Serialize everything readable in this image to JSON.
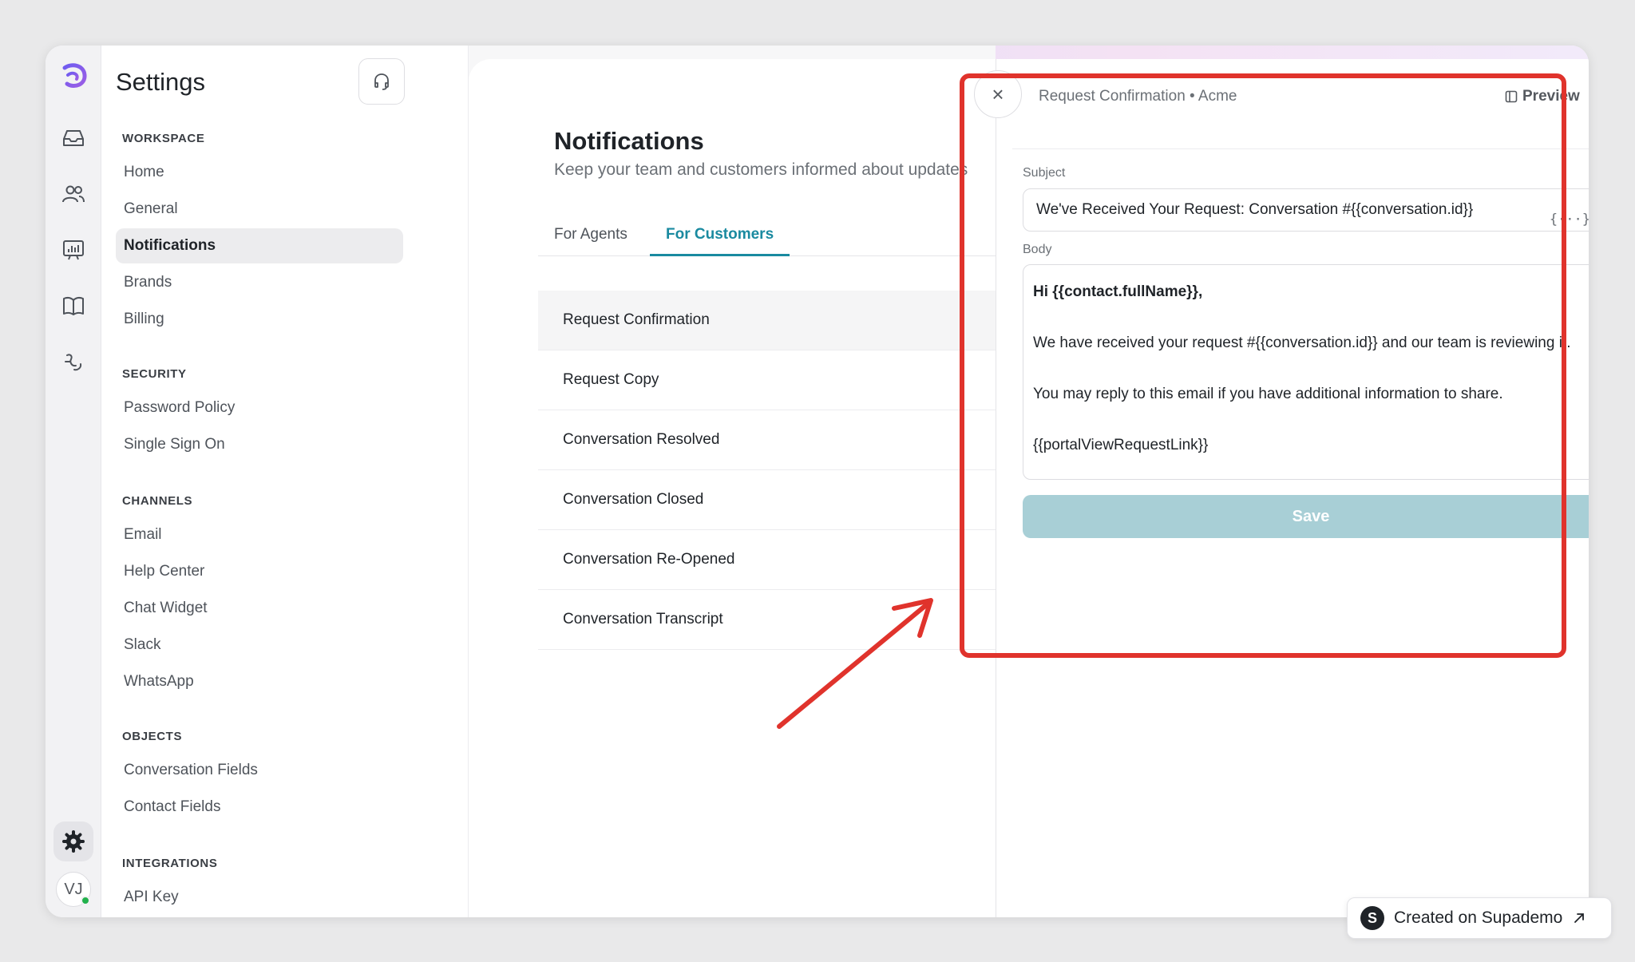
{
  "sidebar": {
    "title": "Settings",
    "sections": [
      {
        "title": "WORKSPACE",
        "items": [
          "Home",
          "General",
          "Notifications",
          "Brands",
          "Billing"
        ]
      },
      {
        "title": "SECURITY",
        "items": [
          "Password Policy",
          "Single Sign On"
        ]
      },
      {
        "title": "CHANNELS",
        "items": [
          "Email",
          "Help Center",
          "Chat Widget",
          "Slack",
          "WhatsApp"
        ]
      },
      {
        "title": "OBJECTS",
        "items": [
          "Conversation Fields",
          "Contact Fields"
        ]
      },
      {
        "title": "INTEGRATIONS",
        "items": [
          "API Key"
        ]
      }
    ],
    "active_item": "Notifications"
  },
  "rail": {
    "avatar_initials": "VJ",
    "icons": [
      "app-logo-icon",
      "inbox-icon",
      "users-icon",
      "reports-icon",
      "knowledge-book-icon",
      "workflow-icon",
      "gear-icon"
    ]
  },
  "main": {
    "heading": "Notifications",
    "subheading": "Keep your team and customers informed about updates",
    "tabs": [
      {
        "label": "For Agents"
      },
      {
        "label": "For Customers"
      }
    ],
    "active_tab": "For Customers",
    "rows": [
      "Request Confirmation",
      "Request Copy",
      "Conversation Resolved",
      "Conversation Closed",
      "Conversation Re-Opened",
      "Conversation Transcript"
    ]
  },
  "panel": {
    "title": "Request Confirmation • Acme",
    "preview_label": "Preview",
    "subject_label": "Subject",
    "subject_value": "We've Received Your Request: Conversation #{{conversation.id}}",
    "variable_icon": "{···}",
    "body_label": "Body",
    "body": {
      "greeting": "Hi {{contact.fullName}},",
      "line1": "We have received your request #{{conversation.id}} and our team is reviewing it.",
      "line2": "You may reply to this email if you have additional information to share.",
      "line3": "{{portalViewRequestLink}}"
    },
    "save_label": "Save"
  },
  "badge": {
    "logo_letter": "S",
    "text": "Created on Supademo"
  },
  "colors": {
    "accent": "#1a8aa0",
    "save_disabled": "#a8cfd6",
    "highlight": "#e0332c",
    "online": "#22b14c"
  }
}
